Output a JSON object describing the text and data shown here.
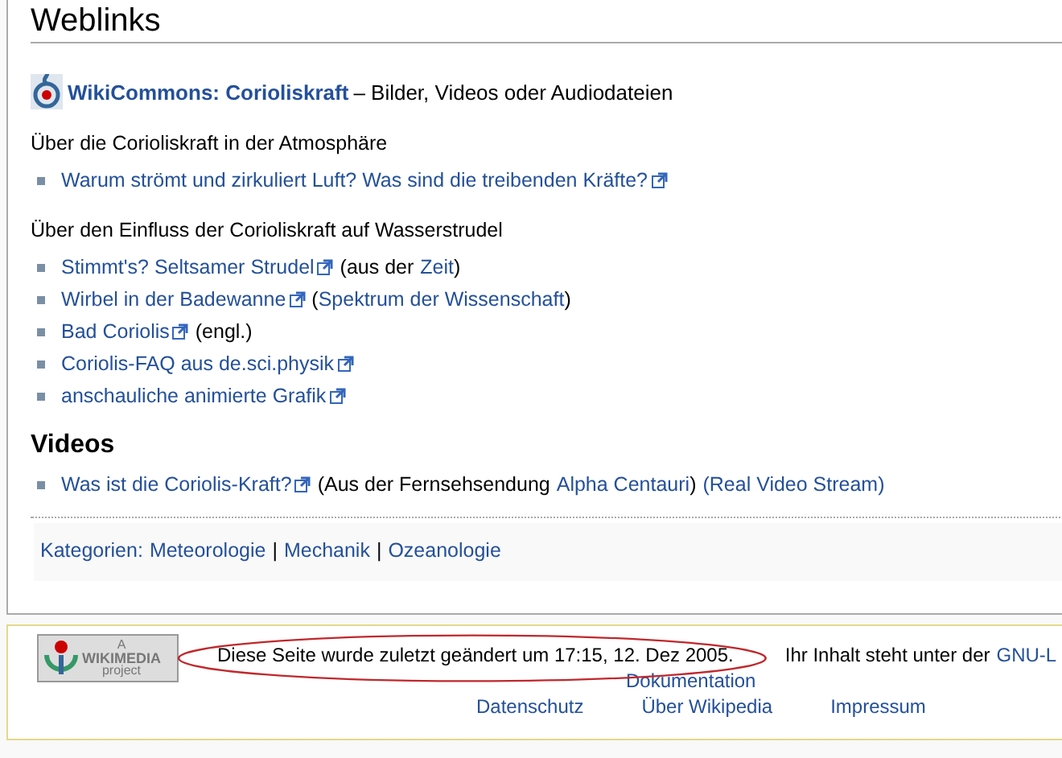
{
  "section_title": "Weblinks",
  "commons": {
    "link": "WikiCommons: Corioliskraft",
    "text": "– Bilder, Videos oder Audiodateien"
  },
  "groups": [
    {
      "intro": "Über die Corioliskraft in der Atmosphäre",
      "items": [
        {
          "parts": [
            {
              "kind": "external",
              "text": "Warum strömt und zirkuliert Luft? Was sind die treibenden Kräfte?"
            }
          ]
        }
      ]
    },
    {
      "intro": "Über den Einfluss der Corioliskraft auf Wasserstrudel",
      "items": [
        {
          "parts": [
            {
              "kind": "external",
              "text": "Stimmt's? Seltsamer Strudel"
            },
            {
              "kind": "plain",
              "text": "(aus der"
            },
            {
              "kind": "link",
              "text": "Zeit"
            },
            {
              "kind": "plain",
              "text": ")",
              "tight": true
            }
          ]
        },
        {
          "parts": [
            {
              "kind": "external",
              "text": "Wirbel in der Badewanne"
            },
            {
              "kind": "plain",
              "text": "("
            },
            {
              "kind": "link",
              "text": "Spektrum der Wissenschaft",
              "tight": true
            },
            {
              "kind": "plain",
              "text": ")",
              "tight": true
            }
          ]
        },
        {
          "parts": [
            {
              "kind": "external",
              "text": "Bad Coriolis"
            },
            {
              "kind": "plain",
              "text": "(engl.)"
            }
          ]
        },
        {
          "parts": [
            {
              "kind": "external",
              "text": "Coriolis-FAQ aus de.sci.physik"
            }
          ]
        },
        {
          "parts": [
            {
              "kind": "external",
              "text": "anschauliche animierte Grafik"
            }
          ]
        }
      ]
    }
  ],
  "videos": {
    "title": "Videos",
    "items": [
      {
        "parts": [
          {
            "kind": "external",
            "text": "Was ist die Coriolis-Kraft?"
          },
          {
            "kind": "plain",
            "text": "(Aus der Fernsehsendung"
          },
          {
            "kind": "link",
            "text": "Alpha Centauri"
          },
          {
            "kind": "plain",
            "text": ")",
            "tight": true
          },
          {
            "kind": "link",
            "text": "(Real Video Stream)"
          }
        ]
      }
    ]
  },
  "categories": {
    "label": "Kategorien:",
    "separator": "|",
    "items": [
      "Meteorologie",
      "Mechanik",
      "Ozeanologie"
    ]
  },
  "footer": {
    "logo": {
      "top": "A",
      "name": "WIKIMEDIA",
      "bottom": "project"
    },
    "last_modified": {
      "text": "Diese Seite wurde zuletzt geändert um 17:15, 12. Dez 2005.",
      "highlighted": true
    },
    "license": {
      "text": "Ihr Inhalt steht unter der",
      "link": "GNU-L"
    },
    "doc_link": "Dokumentation",
    "links": [
      "Datenschutz",
      "Über Wikipedia",
      "Impressum"
    ]
  }
}
